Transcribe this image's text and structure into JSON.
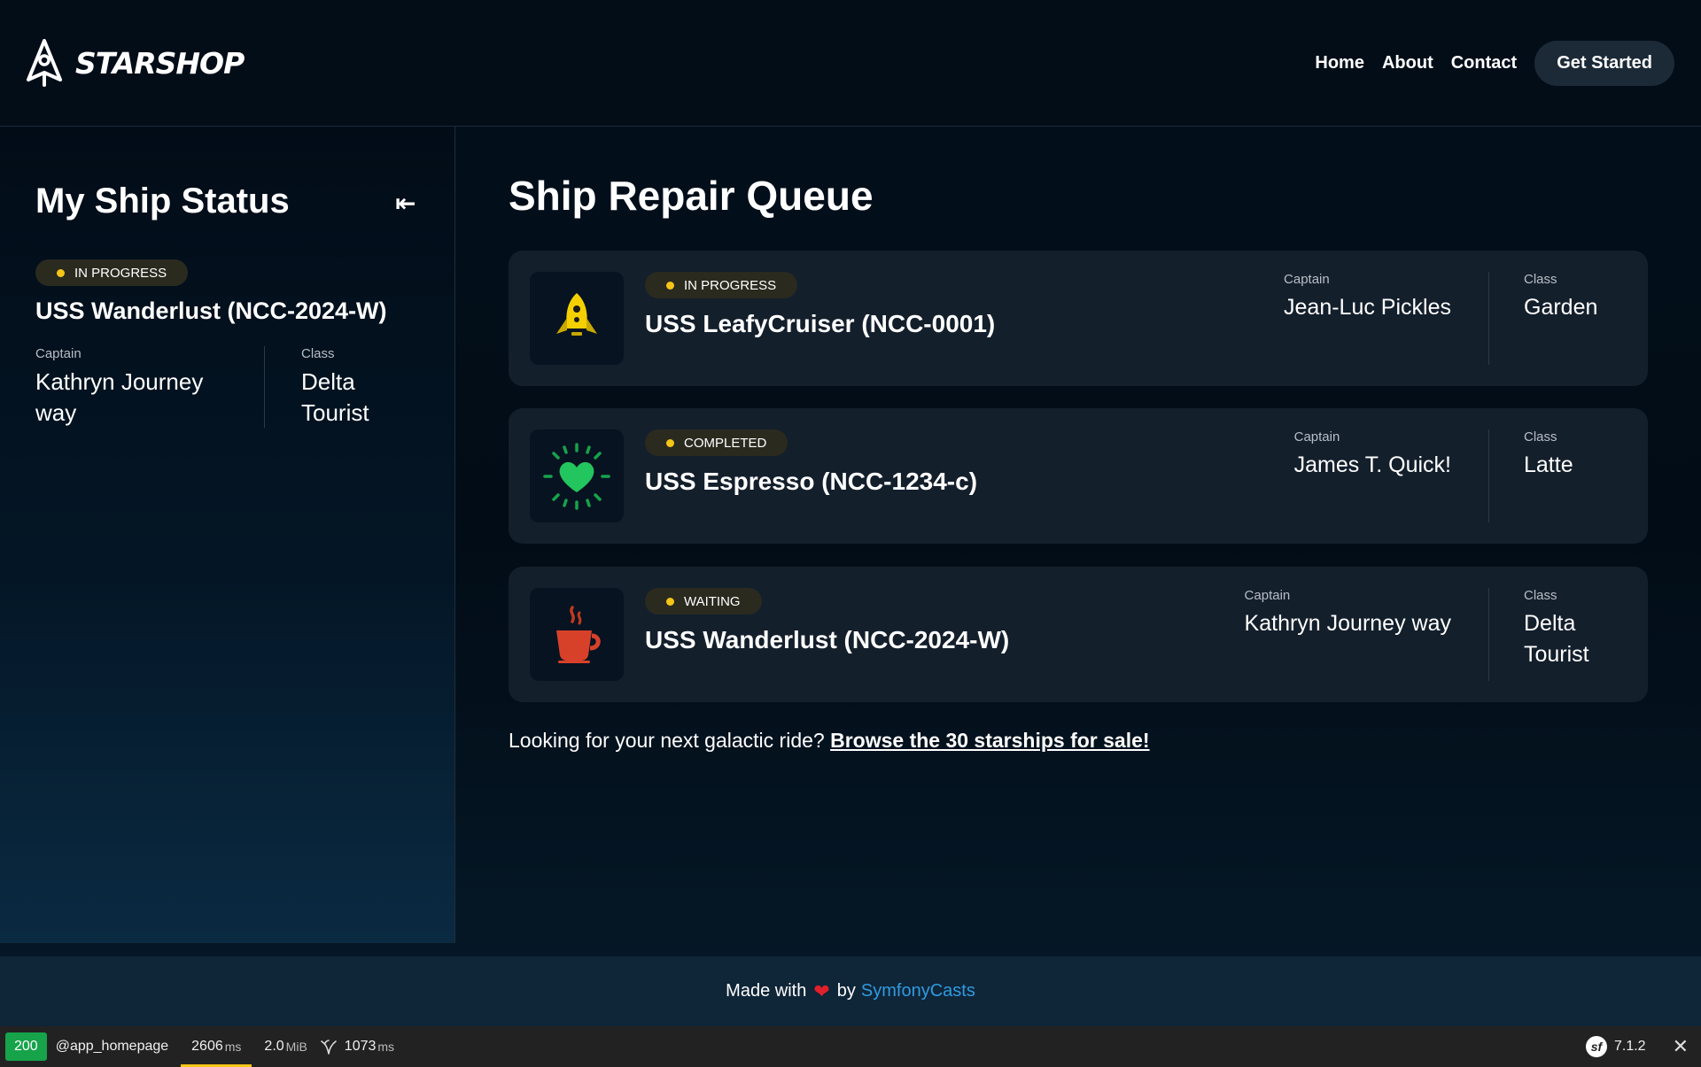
{
  "header": {
    "brand": "STARSHOP",
    "nav": [
      {
        "label": "Home"
      },
      {
        "label": "About"
      },
      {
        "label": "Contact"
      }
    ],
    "cta_label": "Get Started"
  },
  "sidebar": {
    "title": "My Ship Status",
    "collapse_icon": "collapse-left-icon",
    "status": "IN PROGRESS",
    "ship_name": "USS Wanderlust (NCC-2024-W)",
    "captain_label": "Captain",
    "captain_lines": [
      "Kathryn Journey",
      "way"
    ],
    "class_label": "Class",
    "class_lines": [
      "Delta",
      "Tourist"
    ]
  },
  "main": {
    "title": "Ship Repair Queue",
    "ships": [
      {
        "status": "IN PROGRESS",
        "name": "USS LeafyCruiser (NCC-0001)",
        "captain_label": "Captain",
        "captain": "Jean-Luc Pickles",
        "class_label": "Class",
        "class_lines": [
          "Garden"
        ],
        "icon": "rocket-icon"
      },
      {
        "status": "COMPLETED",
        "name": "USS Espresso (NCC-1234-c)",
        "captain_label": "Captain",
        "captain": "James T. Quick!",
        "class_label": "Class",
        "class_lines": [
          "Latte"
        ],
        "icon": "heart-icon"
      },
      {
        "status": "WAITING",
        "name": "USS Wanderlust (NCC-2024-W)",
        "captain_label": "Captain",
        "captain": "Kathryn Journey way",
        "class_label": "Class",
        "class_lines": [
          "Delta",
          "Tourist"
        ],
        "icon": "coffee-cup-icon"
      }
    ],
    "browse_prefix": "Looking for your next galactic ride?",
    "browse_link": "Browse the 30 starships for sale!"
  },
  "footer": {
    "made_with": "Made with",
    "by": "by",
    "link": "SymfonyCasts"
  },
  "toolbar": {
    "status_code": "200",
    "route": "@app_homepage",
    "time_value": "2606",
    "time_unit": "ms",
    "memory_value": "2.0",
    "memory_unit": "MiB",
    "twig_value": "1073",
    "twig_unit": "ms",
    "version": "7.1.2"
  },
  "colors": {
    "status_dot": "#f5c518",
    "link": "#2f9bdf",
    "status_ok": "#16a34a",
    "card_bg": "#141f2c"
  }
}
